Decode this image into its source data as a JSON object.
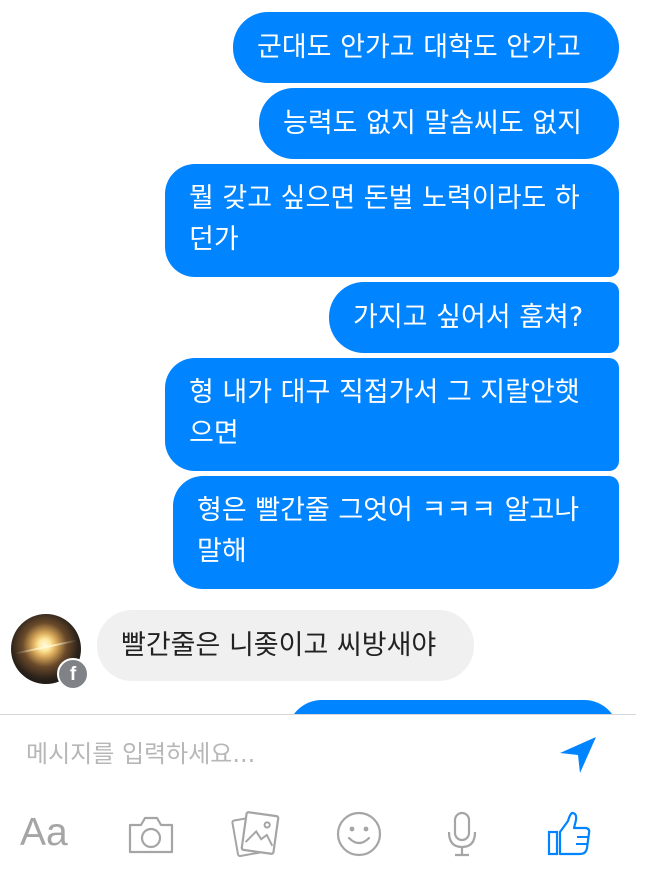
{
  "conversation": {
    "messages": [
      {
        "direction": "outgoing",
        "text": "군대도 안가고 대학도 안가고"
      },
      {
        "direction": "outgoing",
        "text": "능력도 없지 말솜씨도 없지"
      },
      {
        "direction": "outgoing",
        "text": "뭘 갖고 싶으면 돈벌 노력이라도 하\n던가"
      },
      {
        "direction": "outgoing",
        "text": "가지고 싶어서 훔쳐?"
      },
      {
        "direction": "outgoing",
        "text": "형 내가 대구 직접가서 그 지랄안햇\n으면"
      },
      {
        "direction": "outgoing",
        "text": "형은 빨간줄 그엇어 ㅋㅋㅋ 알고나\n말해"
      },
      {
        "direction": "incoming",
        "text": "빨간줄은 니좆이고 씨방새야"
      }
    ]
  },
  "composer": {
    "placeholder": "메시지를 입력하세요...",
    "value": ""
  },
  "toolbar": {
    "font_label": "Aa"
  },
  "colors": {
    "outgoing_bubble": "#0084ff",
    "incoming_bubble": "#f1f0f0",
    "icon_gray": "#a5a5a5",
    "accent": "#0084ff"
  },
  "icons": [
    "facebook-badge-icon",
    "send-icon",
    "camera-icon",
    "gallery-icon",
    "emoji-icon",
    "microphone-icon",
    "like-icon"
  ]
}
